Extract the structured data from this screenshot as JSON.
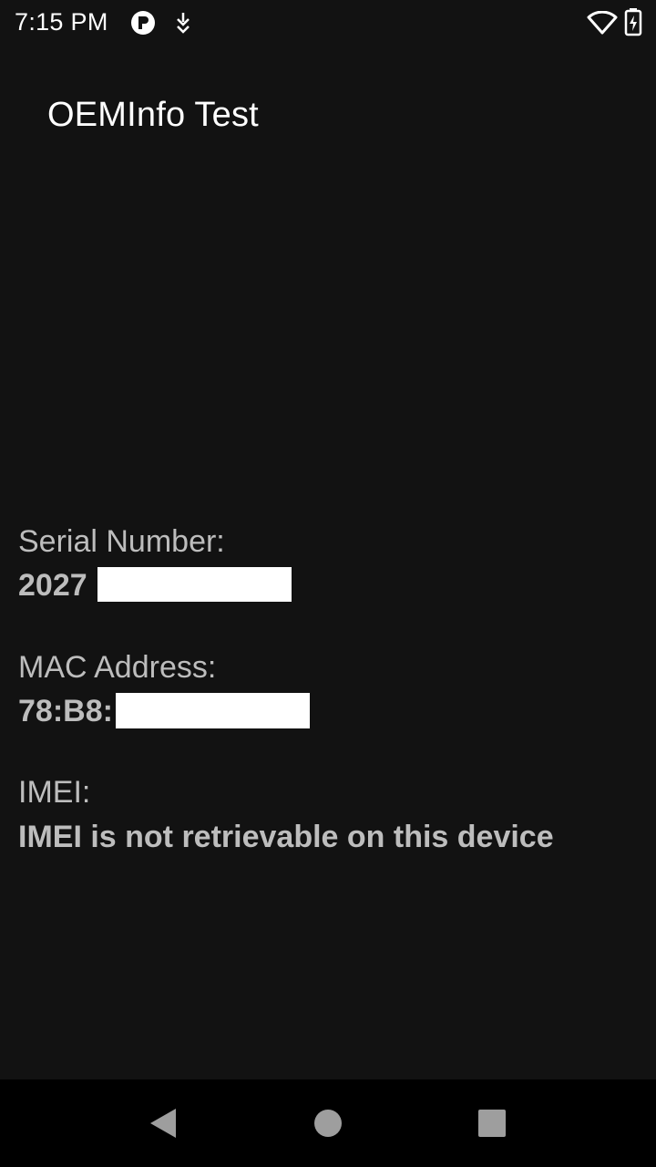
{
  "status_bar": {
    "time": "7:15 PM",
    "icons": [
      "app-notification-icon",
      "download-notification-icon",
      "wifi-icon",
      "battery-charging-icon"
    ]
  },
  "app": {
    "title": "OEMInfo Test"
  },
  "info": {
    "serial": {
      "label": "Serial Number:",
      "value_visible": "2027"
    },
    "mac": {
      "label": "MAC Address:",
      "value_visible": "78:B8:"
    },
    "imei": {
      "label": "IMEI:",
      "value": "IMEI is not retrievable on this device"
    }
  },
  "nav_bar": {
    "buttons": [
      "back-icon",
      "home-icon",
      "recents-icon"
    ]
  },
  "colors": {
    "background": "#121212",
    "nav_background": "#000000",
    "text_primary": "#ffffff",
    "text_secondary": "#bdbdbd",
    "nav_icon": "#9e9e9e"
  }
}
